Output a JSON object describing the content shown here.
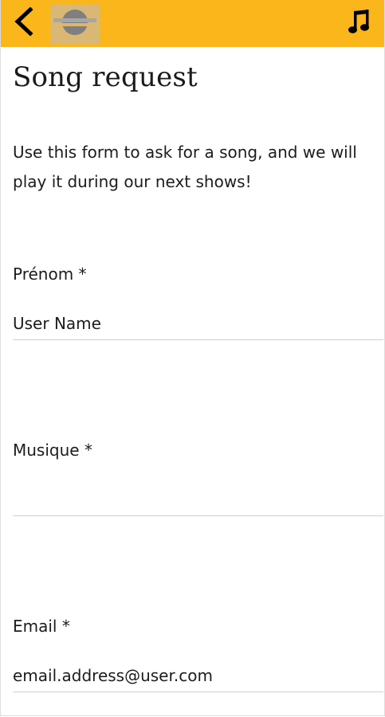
{
  "header": {
    "back_icon": "chevron-left-icon",
    "logo_icon": "station-logo-icon",
    "music_icon": "music-note-icon",
    "bar_color": "#fbb61c"
  },
  "page": {
    "title": "Song request",
    "intro": "Use this form to ask for a song, and we will play it during our next shows!"
  },
  "form": {
    "fields": [
      {
        "label": "Prénom *",
        "value": "User Name",
        "placeholder": ""
      },
      {
        "label": "Musique *",
        "value": "",
        "placeholder": ""
      },
      {
        "label": "Email *",
        "value": "email.address@user.com",
        "placeholder": ""
      }
    ]
  }
}
